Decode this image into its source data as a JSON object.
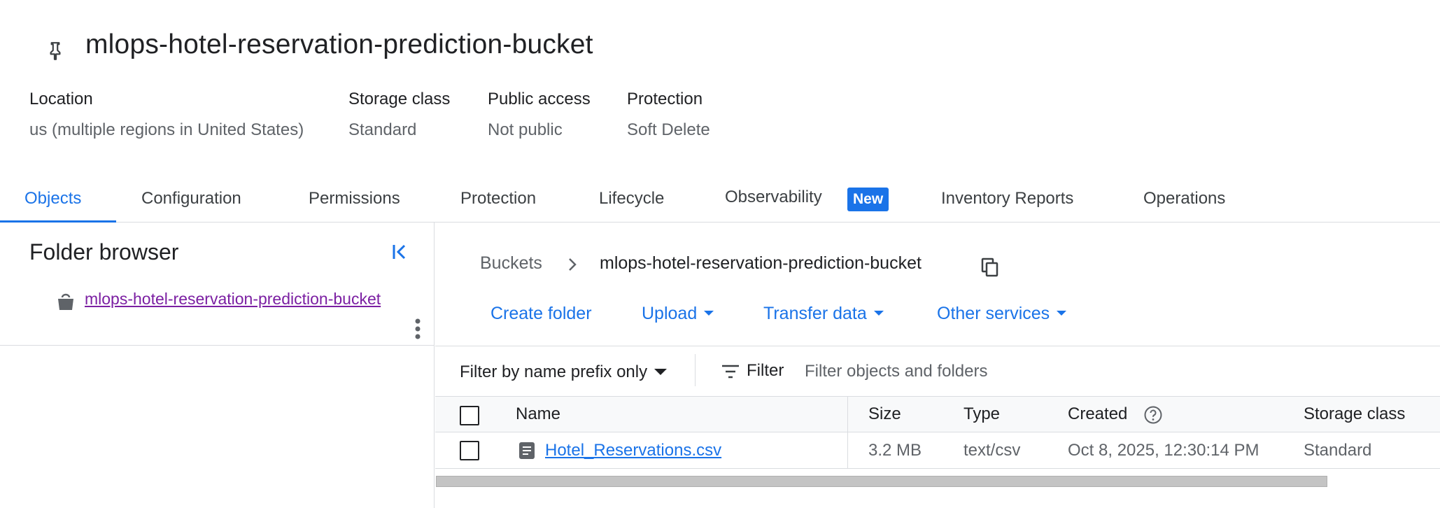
{
  "header": {
    "title": "mlops-hotel-reservation-prediction-bucket"
  },
  "meta": [
    {
      "label": "Location",
      "value": "us (multiple regions in United States)"
    },
    {
      "label": "Storage class",
      "value": "Standard"
    },
    {
      "label": "Public access",
      "value": "Not public"
    },
    {
      "label": "Protection",
      "value": "Soft Delete"
    }
  ],
  "tabs": {
    "objects": "Objects",
    "configuration": "Configuration",
    "permissions": "Permissions",
    "protection": "Protection",
    "lifecycle": "Lifecycle",
    "observability": "Observability",
    "observability_badge": "New",
    "inventory_reports": "Inventory Reports",
    "operations": "Operations",
    "active": "Objects"
  },
  "folder_browser": {
    "title": "Folder browser",
    "bucket_name": "mlops-hotel-reservation-prediction-bucket"
  },
  "breadcrumb": {
    "root": "Buckets",
    "current": "mlops-hotel-reservation-prediction-bucket"
  },
  "actions": {
    "create_folder": "Create folder",
    "upload": "Upload",
    "transfer_data": "Transfer data",
    "other_services": "Other services"
  },
  "filter": {
    "mode": "Filter by name prefix only",
    "label": "Filter",
    "placeholder": "Filter objects and folders"
  },
  "table": {
    "columns": {
      "name": "Name",
      "size": "Size",
      "type": "Type",
      "created": "Created",
      "storage_class": "Storage class"
    },
    "rows": [
      {
        "name": "Hotel_Reservations.csv",
        "size": "3.2 MB",
        "type": "text/csv",
        "created": "Oct 8, 2025, 12:30:14 PM",
        "storage_class": "Standard"
      }
    ]
  },
  "colors": {
    "accent": "#1a73e8",
    "visited_link": "#7b1fa2",
    "text": "#202124",
    "secondary_text": "#5f6368",
    "border": "#dadce0"
  },
  "icons": [
    "pin-icon",
    "collapse-panel-icon",
    "bucket-icon",
    "more-vert-icon",
    "chevron-right-icon",
    "copy-icon",
    "filter-list-icon",
    "help-icon",
    "file-icon"
  ]
}
